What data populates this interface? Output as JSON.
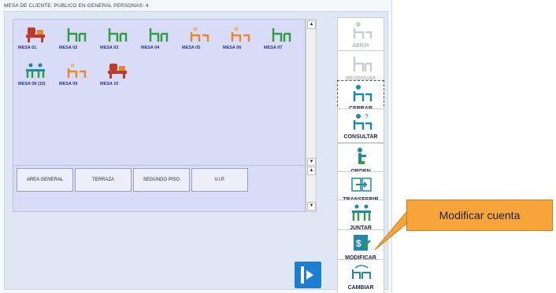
{
  "window": {
    "title": "MESA DE  CLIENTE: PUBLICO EN GENERAL  PERSONAS: 4"
  },
  "tables": [
    {
      "label": "MESA 01",
      "state": "occupied",
      "icon": "table-occupied-icon"
    },
    {
      "label": "MESA 02",
      "state": "free",
      "icon": "table-free-icon"
    },
    {
      "label": "MESA 03",
      "state": "free",
      "icon": "table-free-icon"
    },
    {
      "label": "MESA 04",
      "state": "free",
      "icon": "table-free-icon"
    },
    {
      "label": "MESA 05",
      "state": "reserved",
      "icon": "table-reserved-icon"
    },
    {
      "label": "MESA 06",
      "state": "reserved",
      "icon": "table-reserved-icon"
    },
    {
      "label": "MESA 07",
      "state": "free",
      "icon": "table-free-icon"
    },
    {
      "label": "MESA 08 (10)",
      "state": "joined",
      "icon": "table-joined-icon"
    },
    {
      "label": "MESA 09",
      "state": "reserved",
      "icon": "table-reserved-icon"
    },
    {
      "label": "MESA 10",
      "state": "occupied",
      "icon": "table-occupied-icon"
    }
  ],
  "areas": [
    {
      "label": "AREA GENERAL"
    },
    {
      "label": "TERRAZA"
    },
    {
      "label": "SEGUNDO PISO"
    },
    {
      "label": "V.I.P."
    }
  ],
  "actions": [
    {
      "label": "ABRIR",
      "icon": "open-table-icon",
      "enabled": false
    },
    {
      "label": "RESERVAR",
      "icon": "reserve-table-icon",
      "enabled": false
    },
    {
      "label": "CERRAR",
      "icon": "close-table-icon",
      "enabled": true
    },
    {
      "label": "CONSULTAR",
      "icon": "query-table-icon",
      "enabled": true
    },
    {
      "label": "ORDEN",
      "icon": "order-icon",
      "enabled": true
    },
    {
      "label": "TRANSFERIR",
      "icon": "transfer-icon",
      "enabled": true
    },
    {
      "label": "JUNTAR",
      "icon": "join-tables-icon",
      "enabled": true
    },
    {
      "label": "MODIFICAR",
      "icon": "modify-account-icon",
      "enabled": true
    },
    {
      "label": "CAMBIAR",
      "icon": "change-table-icon",
      "enabled": true
    }
  ],
  "exit_button": {
    "icon": "exit-icon"
  },
  "callout": {
    "text": "Modificar cuenta"
  },
  "colors": {
    "occupied": "#c0392b",
    "free": "#2f9e47",
    "reserved": "#e58a2f",
    "joined": "#1e8aa6",
    "label_blue": "#2234a4",
    "callout": "#f7a43a"
  }
}
